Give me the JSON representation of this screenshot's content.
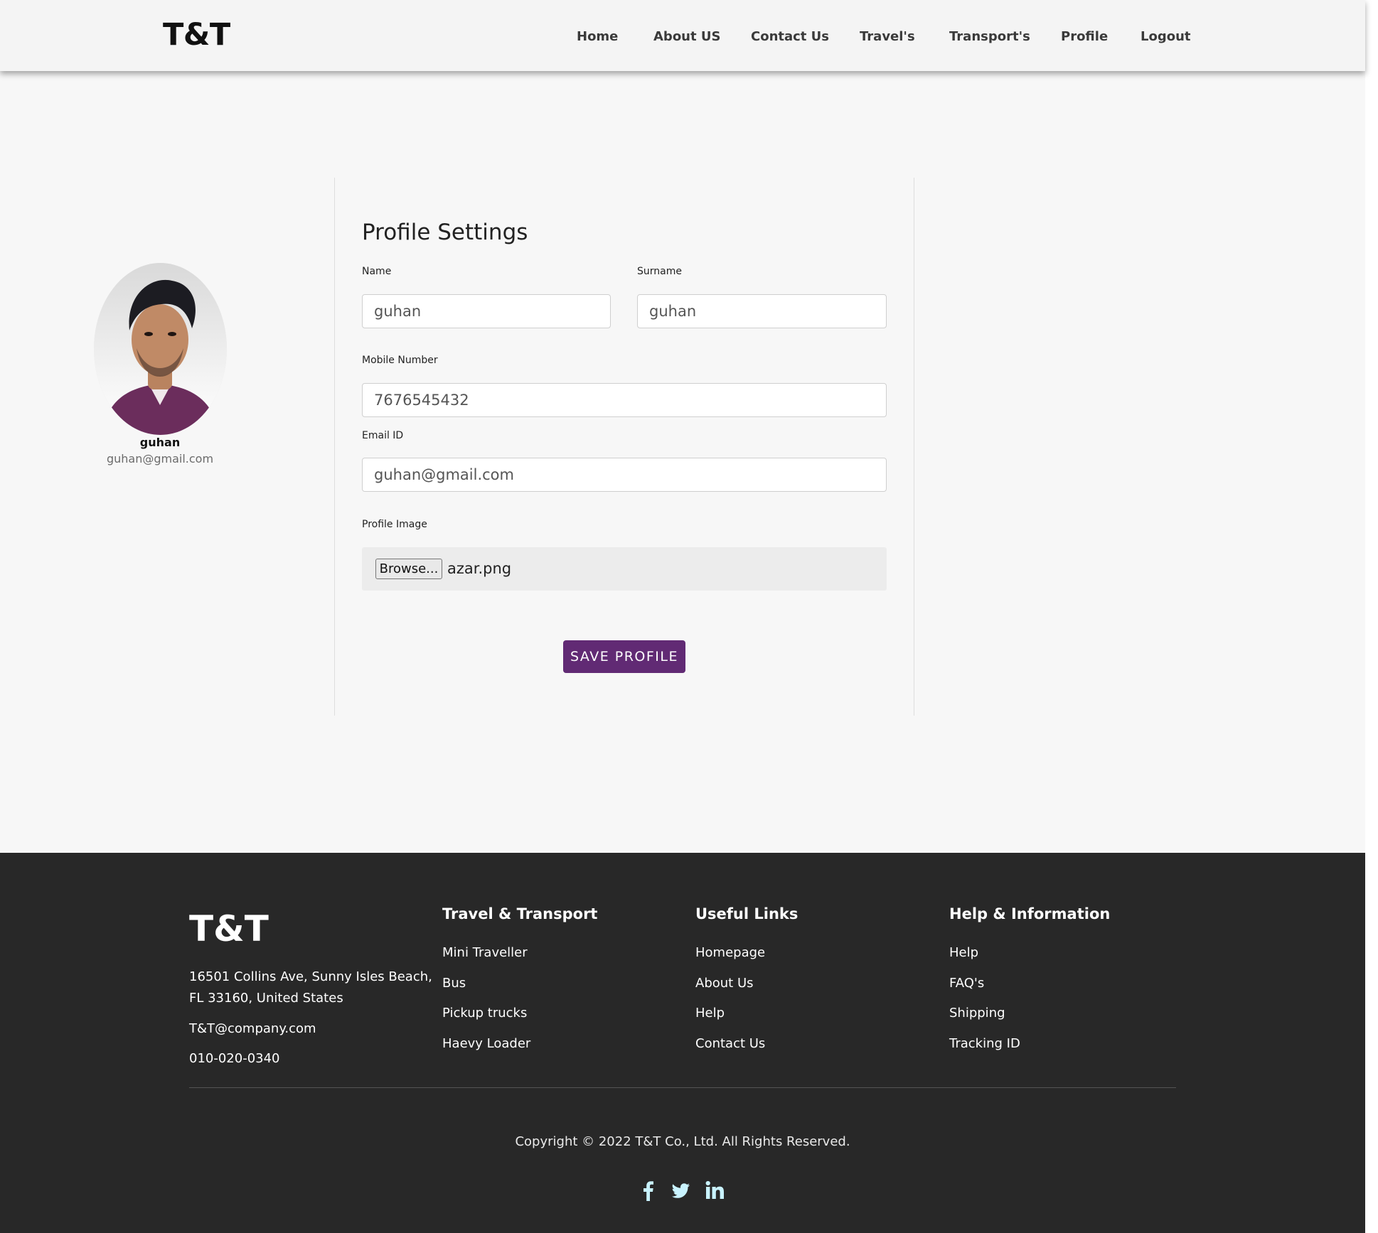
{
  "header": {
    "logo": "T&T",
    "nav": [
      "Home",
      "About US",
      "Contact Us",
      "Travel's",
      "Transport's",
      "Profile",
      "Logout"
    ]
  },
  "sidebar": {
    "avatar_icon": "user-avatar-photo",
    "name": "guhan",
    "email": "guhan@gmail.com"
  },
  "form": {
    "title": "Profile Settings",
    "name_label": "Name",
    "name_value": "guhan",
    "surname_label": "Surname",
    "surname_value": "guhan",
    "mobile_label": "Mobile Number",
    "mobile_value": "7676545432",
    "email_label": "Email ID",
    "email_value": "guhan@gmail.com",
    "image_label": "Profile Image",
    "browse_label": "Browse...",
    "file_name": "azar.png",
    "save_label": "SAVE PROFILE",
    "save_color": "#612a74"
  },
  "footer": {
    "logo": "T&T",
    "address_line1": "16501 Collins Ave, Sunny Isles Beach,",
    "address_line2": "FL 33160, United States",
    "email": "T&T@company.com",
    "phone": "010-020-0340",
    "col1": {
      "heading": "Travel & Transport",
      "links": [
        "Mini Traveller",
        "Bus",
        "Pickup trucks",
        "Haevy Loader"
      ]
    },
    "col2": {
      "heading": "Useful Links",
      "links": [
        "Homepage",
        "About Us",
        "Help",
        "Contact Us"
      ]
    },
    "col3": {
      "heading": "Help & Information",
      "links": [
        "Help",
        "FAQ's",
        "Shipping",
        "Tracking ID"
      ]
    },
    "copyright": "Copyright © 2022 T&T Co., Ltd. All Rights Reserved.",
    "social_icons": [
      "facebook-icon",
      "twitter-icon",
      "linkedin-icon"
    ],
    "social_color": "#c9f3ff",
    "background": "#282828"
  }
}
